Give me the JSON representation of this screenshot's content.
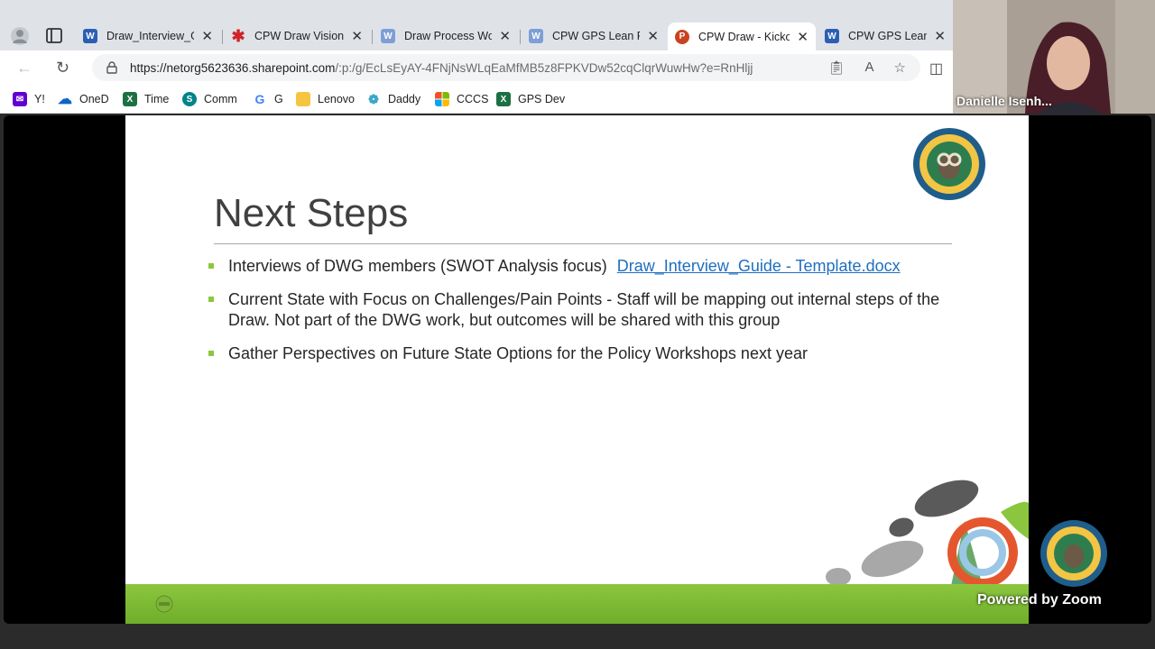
{
  "browser": {
    "tabs": [
      {
        "title": "Draw_Interview_Gu",
        "icon": "word-icon",
        "active": false
      },
      {
        "title": "CPW Draw Vision",
        "icon": "asterisk-icon",
        "active": false
      },
      {
        "title": "Draw Process Wor",
        "icon": "word-icon",
        "active": false
      },
      {
        "title": "CPW GPS Lean Pro",
        "icon": "word-icon",
        "active": false
      },
      {
        "title": "CPW Draw - Kickof",
        "icon": "powerpoint-icon",
        "active": true
      },
      {
        "title": "CPW GPS Lean Pro",
        "icon": "word-icon",
        "active": false
      }
    ],
    "close_glyph": "✕",
    "url": {
      "host": "https://netorg5623636.sharepoint.com",
      "path": "/:p:/g/EcLsEyAY-4FNjNsWLqEaMfMB5z8FPKVDw52cqClqrWuwHw?e=RnHljj"
    },
    "bookmarks": [
      {
        "label": "Y!",
        "icon": "mail-icon"
      },
      {
        "label": "OneD",
        "icon": "onedrive-icon"
      },
      {
        "label": "Time",
        "icon": "excel-icon"
      },
      {
        "label": "Comm",
        "icon": "sharepoint-icon"
      },
      {
        "label": "G",
        "icon": "google-icon"
      },
      {
        "label": "Lenovo",
        "icon": "folder-icon"
      },
      {
        "label": "Daddy",
        "icon": "swirl-icon"
      },
      {
        "label": "CCCS",
        "icon": "microsoft-icon"
      },
      {
        "label": "GPS Dev",
        "icon": "excel-icon"
      }
    ],
    "colors": {
      "tabbar": "#dfe3e8",
      "active_tab": "#ffffff"
    }
  },
  "slide": {
    "title": "Next Steps",
    "bullets": [
      {
        "text": "Interviews of DWG members (SWOT Analysis focus)",
        "link": "Draw_Interview_Guide - Template.docx"
      },
      {
        "text": "Current State with Focus on Challenges/Pain Points  - Staff will be mapping out internal steps of the Draw.  Not part of the DWG work, but outcomes will be shared with this group",
        "link": ""
      },
      {
        "text": "Gather Perspectives on Future State Options for the Policy Workshops next year",
        "link": ""
      }
    ],
    "colors": {
      "accent_green": "#8dc63f",
      "link": "#1f6fbf",
      "title": "#404040"
    }
  },
  "zoom": {
    "participant_name": "Danielle Isenh...",
    "powered_by": "Powered by Zoom"
  }
}
